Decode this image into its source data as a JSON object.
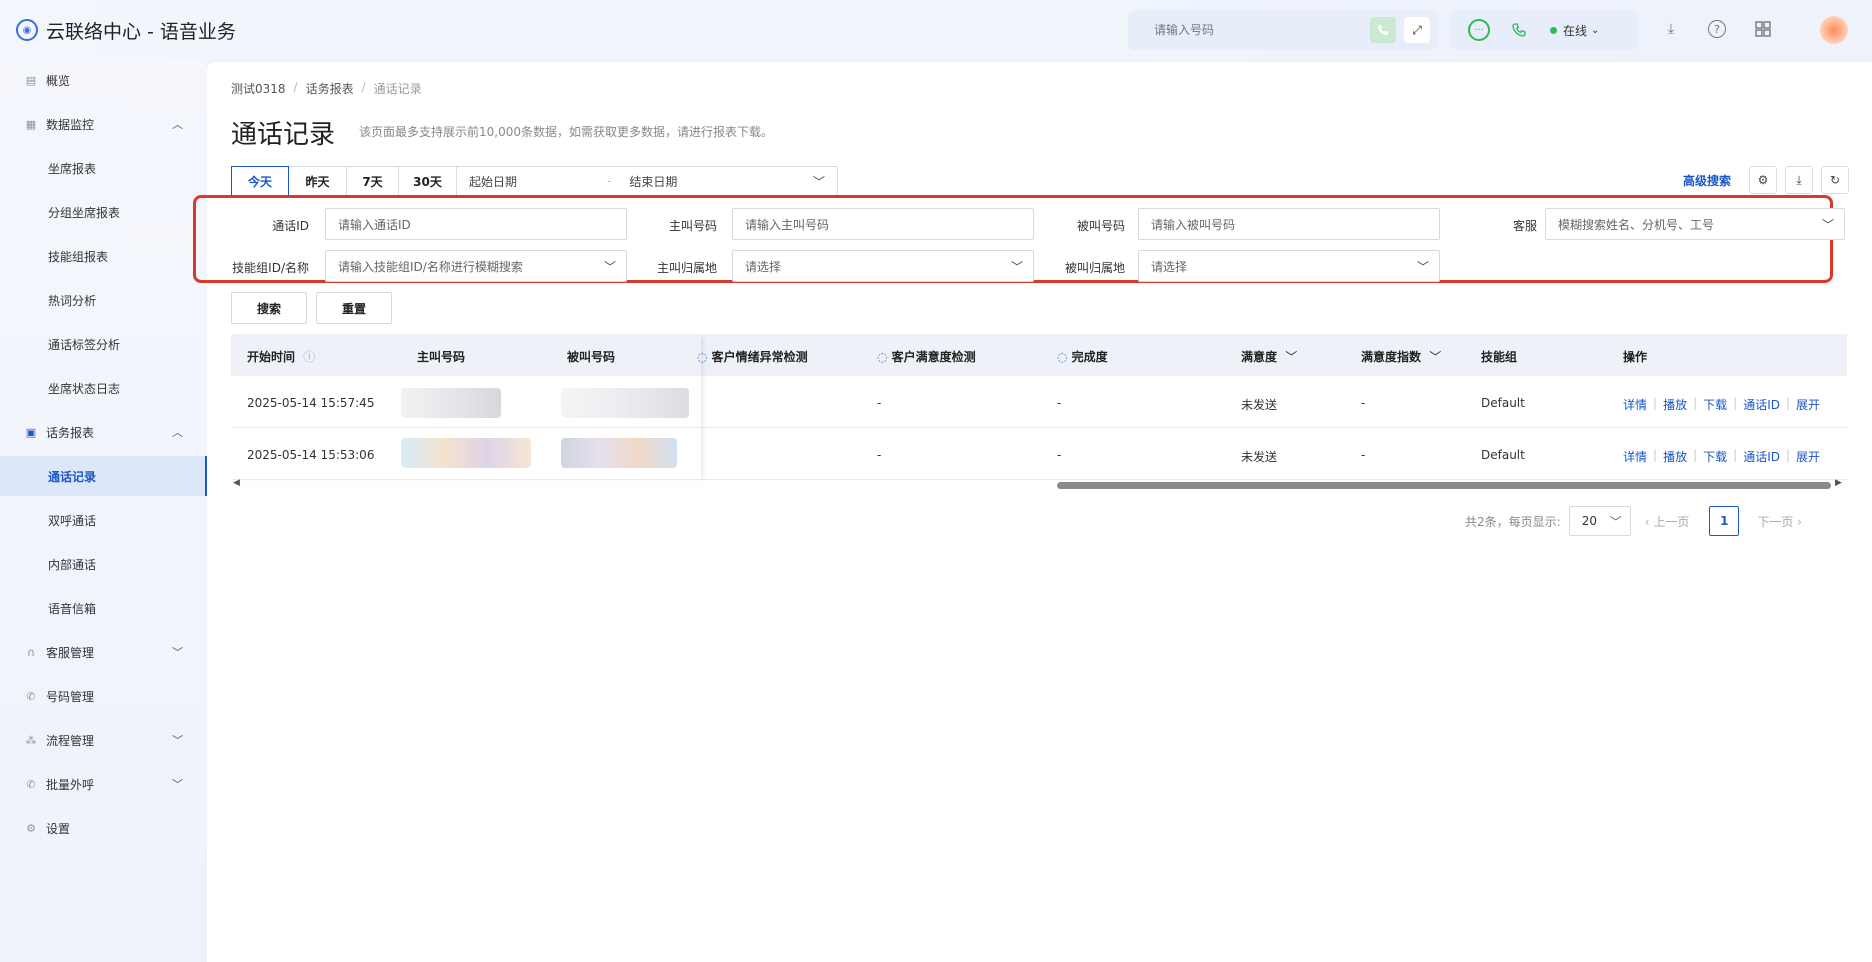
{
  "app": {
    "title": "云联络中心 - 语音业务"
  },
  "topbar": {
    "search_placeholder": "请输入号码",
    "status": "在线"
  },
  "sidebar": {
    "items": [
      {
        "label": "概览",
        "icon": "overview-icon"
      },
      {
        "label": "数据监控",
        "icon": "monitor-icon",
        "expanded": true
      },
      {
        "label": "坐席报表"
      },
      {
        "label": "分组坐席报表"
      },
      {
        "label": "技能组报表"
      },
      {
        "label": "热词分析"
      },
      {
        "label": "通话标签分析"
      },
      {
        "label": "坐席状态日志"
      },
      {
        "label": "话务报表",
        "icon": "report-icon",
        "expanded": true
      },
      {
        "label": "通话记录",
        "active": true
      },
      {
        "label": "双呼通话"
      },
      {
        "label": "内部通话"
      },
      {
        "label": "语音信箱"
      },
      {
        "label": "客服管理",
        "icon": "headset-icon"
      },
      {
        "label": "号码管理",
        "icon": "phone-icon"
      },
      {
        "label": "流程管理",
        "icon": "flow-icon"
      },
      {
        "label": "批量外呼",
        "icon": "outbound-icon"
      },
      {
        "label": "设置",
        "icon": "settings-icon"
      }
    ]
  },
  "breadcrumb": [
    "测试0318",
    "话务报表",
    "通话记录"
  ],
  "page": {
    "title": "通话记录",
    "note": "该页面最多支持展示前10,000条数据，如需获取更多数据，请进行报表下载。"
  },
  "date_tabs": [
    "今天",
    "昨天",
    "7天",
    "30天"
  ],
  "date_range": {
    "start": "起始日期",
    "sep": "-",
    "end": "结束日期"
  },
  "advanced_search": "高级搜索",
  "filters": {
    "call_id": {
      "label": "通话ID",
      "placeholder": "请输入通话ID"
    },
    "caller": {
      "label": "主叫号码",
      "placeholder": "请输入主叫号码"
    },
    "callee": {
      "label": "被叫号码",
      "placeholder": "请输入被叫号码"
    },
    "agent": {
      "label": "客服",
      "placeholder": "模糊搜索姓名、分机号、工号"
    },
    "skill_group": {
      "label": "技能组ID/名称",
      "placeholder": "请输入技能组ID/名称进行模糊搜索"
    },
    "caller_region": {
      "label": "主叫归属地",
      "placeholder": "请选择"
    },
    "callee_region": {
      "label": "被叫归属地",
      "placeholder": "请选择"
    }
  },
  "buttons": {
    "search": "搜索",
    "reset": "重置"
  },
  "table": {
    "headers": [
      "开始时间",
      "主叫号码",
      "被叫号码",
      "客户情绪异常检测",
      "客户满意度检测",
      "完成度",
      "满意度",
      "满意度指数",
      "技能组",
      "操作"
    ],
    "rows": [
      {
        "start": "2025-05-14 15:57:45",
        "emotion": "-",
        "satisfaction_check": "-",
        "completion": "-",
        "satisfaction": "未发送",
        "index": "-",
        "group": "Default"
      },
      {
        "start": "2025-05-14 15:53:06",
        "emotion": "-",
        "satisfaction_check": "-",
        "completion": "-",
        "satisfaction": "未发送",
        "index": "-",
        "group": "Default"
      }
    ],
    "ops": [
      "详情",
      "播放",
      "下载",
      "通话ID",
      "展开"
    ]
  },
  "pager": {
    "summary": "共2条，每页显示:",
    "page_size": "20",
    "prev": "上一页",
    "current": "1",
    "next": "下一页"
  }
}
